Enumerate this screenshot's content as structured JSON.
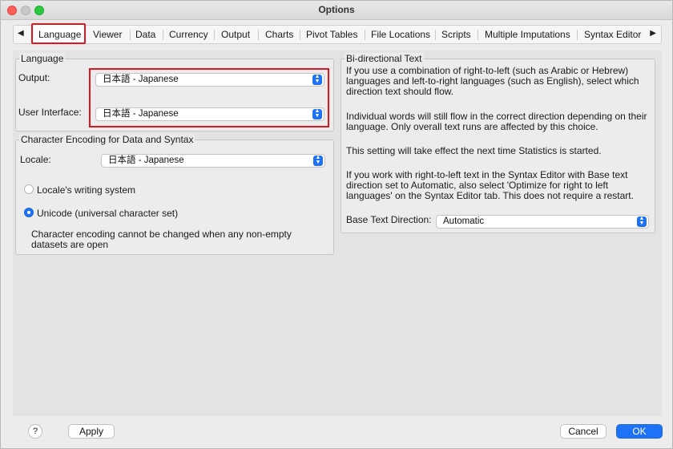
{
  "window": {
    "title": "Options"
  },
  "tabs": [
    {
      "label": "Language"
    },
    {
      "label": "Viewer"
    },
    {
      "label": "Data"
    },
    {
      "label": "Currency"
    },
    {
      "label": "Output"
    },
    {
      "label": "Charts"
    },
    {
      "label": "Pivot Tables"
    },
    {
      "label": "File Locations"
    },
    {
      "label": "Scripts"
    },
    {
      "label": "Multiple Imputations"
    },
    {
      "label": "Syntax Editor"
    }
  ],
  "language": {
    "legend": "Language",
    "output_label": "Output:",
    "output_value": "日本語 - Japanese",
    "ui_label": "User Interface:",
    "ui_value": "日本語 - Japanese"
  },
  "encoding": {
    "legend": "Character Encoding for Data and Syntax",
    "locale_label": "Locale:",
    "locale_value": "日本語 - Japanese",
    "option_locale": "Locale's writing system",
    "option_unicode": "Unicode (universal character set)",
    "selected": "unicode",
    "note": "Character encoding cannot be changed when any non-empty datasets are open"
  },
  "bidi": {
    "legend": "Bi-directional Text",
    "para1": "If you use a combination of right-to-left (such as Arabic or Hebrew) languages and left-to-right languages (such as English), select which direction text should flow.",
    "para2": "Individual words will still flow in the correct direction depending on their language. Only overall text runs are affected by this choice.",
    "para3": "This setting will take effect the next time Statistics is started.",
    "para4": "If you work with right-to-left text in the Syntax Editor with Base text direction set to Automatic, also select 'Optimize for right to left languages' on the Syntax Editor tab. This does not require a restart.",
    "direction_label": "Base Text Direction:",
    "direction_value": "Automatic"
  },
  "footer": {
    "help_label": "?",
    "apply_label": "Apply",
    "cancel_label": "Cancel",
    "ok_label": "OK"
  },
  "colors": {
    "accent": "#1e72f5",
    "highlight": "#e0161b"
  }
}
